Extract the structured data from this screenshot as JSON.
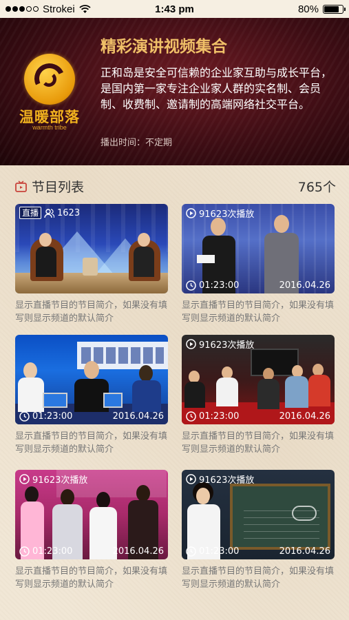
{
  "status_bar": {
    "carrier": "Strokei",
    "time": "1:43 pm",
    "battery": "80%",
    "battery_level": 0.8,
    "signal_bars_filled": 3,
    "signal_bars_total": 5
  },
  "banner": {
    "logo_name": "温暖部落",
    "logo_sub": "warmth tribe",
    "title": "精彩演讲视频集合",
    "description": "正和岛是安全可信赖的企业家互助与成长平台，是国内第一家专注企业家人群的实名制、会员制、收费制、邀请制的高端网络社交平台。",
    "schedule": "播出时间：不定期"
  },
  "section": {
    "title": "节目列表",
    "count": "765个",
    "icon": "tv-icon"
  },
  "programs": [
    {
      "live_label": "直播",
      "viewers": "1623",
      "caption": "显示直播节目的节目简介，如果没有填写则显示频道的默认简介"
    },
    {
      "plays": "91623次播放",
      "duration": "01:23:00",
      "date": "2016.04.26",
      "caption": "显示直播节目的节目简介，如果没有填写则显示频道的默认简介"
    },
    {
      "duration": "01:23:00",
      "date": "2016.04.26",
      "caption": "显示直播节目的节目简介，如果没有填写则显示频道的默认简介"
    },
    {
      "plays": "91623次播放",
      "duration": "01:23:00",
      "date": "2016.04.26",
      "caption": "显示直播节目的节目简介，如果没有填写则显示频道的默认简介"
    },
    {
      "plays": "91623次播放",
      "duration": "01:23:00",
      "date": "2016.04.26",
      "caption": "显示直播节目的节目简介，如果没有填写则显示频道的默认简介"
    },
    {
      "plays": "91623次播放",
      "duration": "01:23:00",
      "date": "2016.04.26",
      "caption": "显示直播节目的节目简介，如果没有填写则显示频道的默认简介"
    }
  ],
  "colors": {
    "banner_bg": "#3d0d14",
    "banner_title": "#f0c068",
    "logo_gold": "#f1b21e",
    "caption_text": "#777777",
    "page_bg": "#f1e7d6"
  }
}
